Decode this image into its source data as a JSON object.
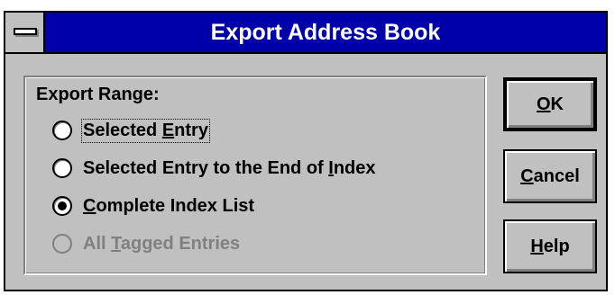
{
  "window": {
    "title": "Export Address Book"
  },
  "group": {
    "label": "Export Range:",
    "options": [
      {
        "pre": "Selected ",
        "mn": "E",
        "post": "ntry",
        "checked": false,
        "enabled": true,
        "focused": true
      },
      {
        "pre": "Selected Entry to the End of ",
        "mn": "I",
        "post": "ndex",
        "checked": false,
        "enabled": true,
        "focused": false
      },
      {
        "pre": "",
        "mn": "C",
        "post": "omplete Index List",
        "checked": true,
        "enabled": true,
        "focused": false
      },
      {
        "pre": "All ",
        "mn": "T",
        "post": "agged Entries",
        "checked": false,
        "enabled": false,
        "focused": false
      }
    ]
  },
  "buttons": {
    "ok": {
      "pre": "",
      "mn": "O",
      "post": "K"
    },
    "cancel": {
      "pre": "",
      "mn": "C",
      "post": "ancel"
    },
    "help": {
      "pre": "",
      "mn": "H",
      "post": "elp"
    }
  },
  "colors": {
    "title_bar": "#0000aa",
    "face": "#c0c0c0",
    "disabled_text": "#808080"
  }
}
